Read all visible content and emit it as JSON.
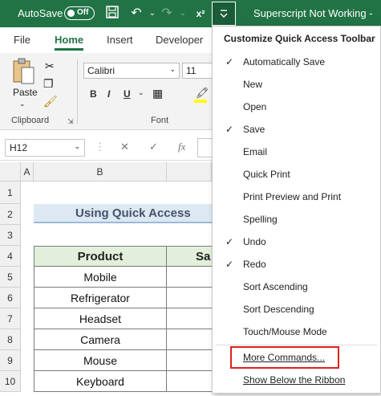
{
  "titlebar": {
    "autosave_label": "AutoSave",
    "autosave_state": "Off",
    "title": "Superscript Not Working -",
    "superscript_icon": "x²"
  },
  "tabs": [
    "File",
    "Home",
    "Insert",
    "Developer"
  ],
  "ribbon": {
    "paste_label": "Paste",
    "font_name": "Calibri",
    "font_size": "11",
    "bold": "B",
    "italic": "I",
    "underline": "U",
    "clipboard_label": "Clipboard",
    "font_label": "Font"
  },
  "formula": {
    "name_box": "H12",
    "fx": "fx",
    "cancel": "✕",
    "confirm": "✓"
  },
  "grid": {
    "columns": [
      "A",
      "B"
    ],
    "rows": [
      "1",
      "2",
      "3",
      "4",
      "5",
      "6",
      "7",
      "8",
      "9",
      "10"
    ],
    "title": "Using Quick Access",
    "header_product": "Product",
    "header_sales": "Sa",
    "products": [
      "Mobile",
      "Refrigerator",
      "Headset",
      "Camera",
      "Mouse",
      "Keyboard"
    ]
  },
  "menu": {
    "header": "Customize Quick Access Toolbar",
    "items": [
      {
        "label": "Automatically Save",
        "checked": "✓"
      },
      {
        "label": "New",
        "checked": ""
      },
      {
        "label": "Open",
        "checked": ""
      },
      {
        "label": "Save",
        "checked": "✓"
      },
      {
        "label": "Email",
        "checked": ""
      },
      {
        "label": "Quick Print",
        "checked": ""
      },
      {
        "label": "Print Preview and Print",
        "checked": ""
      },
      {
        "label": "Spelling",
        "checked": ""
      },
      {
        "label": "Undo",
        "checked": "✓"
      },
      {
        "label": "Redo",
        "checked": "✓"
      },
      {
        "label": "Sort Ascending",
        "checked": ""
      },
      {
        "label": "Sort Descending",
        "checked": ""
      },
      {
        "label": "Touch/Mouse Mode",
        "checked": ""
      },
      {
        "label": "More Commands...",
        "checked": ""
      },
      {
        "label": "Show Below the Ribbon",
        "checked": ""
      }
    ]
  },
  "colors": {
    "excel_green": "#217346",
    "highlight": "#e02020",
    "header_fill": "#e2efda",
    "title_fill": "#dde8f3"
  }
}
